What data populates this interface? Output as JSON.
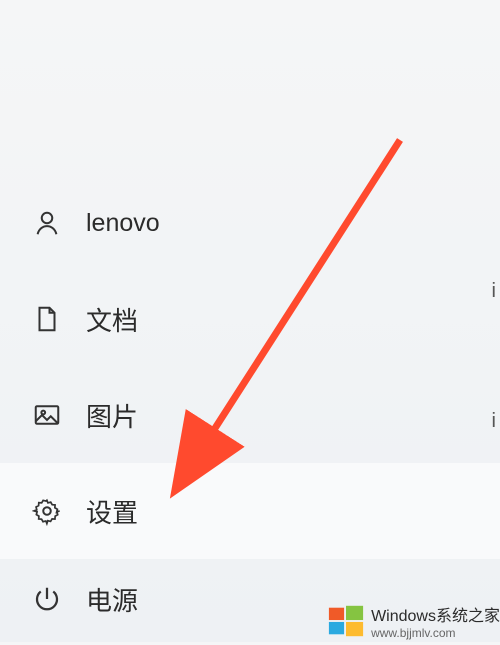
{
  "menu": {
    "user_label": "lenovo",
    "documents_label": "文档",
    "pictures_label": "图片",
    "settings_label": "设置",
    "power_label": "电源"
  },
  "watermark": {
    "title": "Windows系统之家",
    "url": "www.bjjmlv.com"
  },
  "side_fragments": {
    "a": "i",
    "b": "i"
  }
}
